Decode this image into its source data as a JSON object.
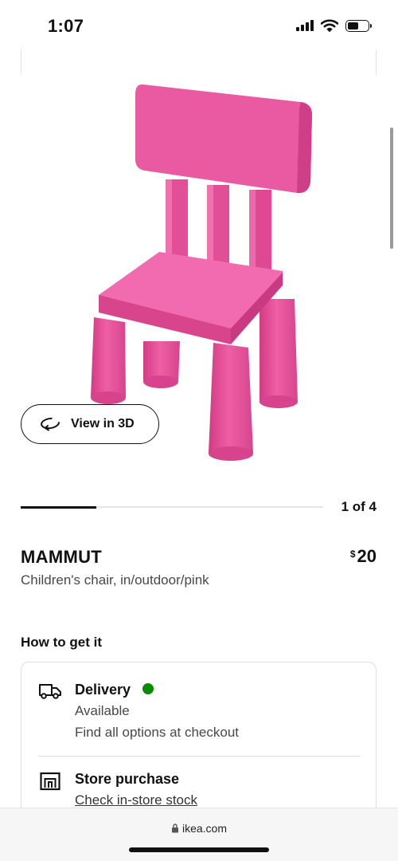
{
  "status_bar": {
    "time": "1:07",
    "battery_level": 0.55
  },
  "product": {
    "name": "MAMMUT",
    "description": "Children's chair, in/outdoor/pink",
    "price_currency": "$",
    "price_amount": "20",
    "color": "#e8529b"
  },
  "viewer": {
    "view3d_label": "View in 3D"
  },
  "carousel": {
    "count_text": "1 of 4",
    "current": 1,
    "total": 4
  },
  "how_to_get": {
    "title": "How to get it",
    "delivery": {
      "title": "Delivery",
      "status": "Available",
      "detail": "Find all options at checkout",
      "status_color": "#0a8a00"
    },
    "store": {
      "title": "Store purchase",
      "link": "Check in-store stock"
    }
  },
  "browser": {
    "url": "ikea.com"
  },
  "icons": [
    "signal-icon",
    "wifi-icon",
    "battery-icon",
    "rotate-3d-icon",
    "truck-icon",
    "store-icon",
    "lock-icon"
  ]
}
